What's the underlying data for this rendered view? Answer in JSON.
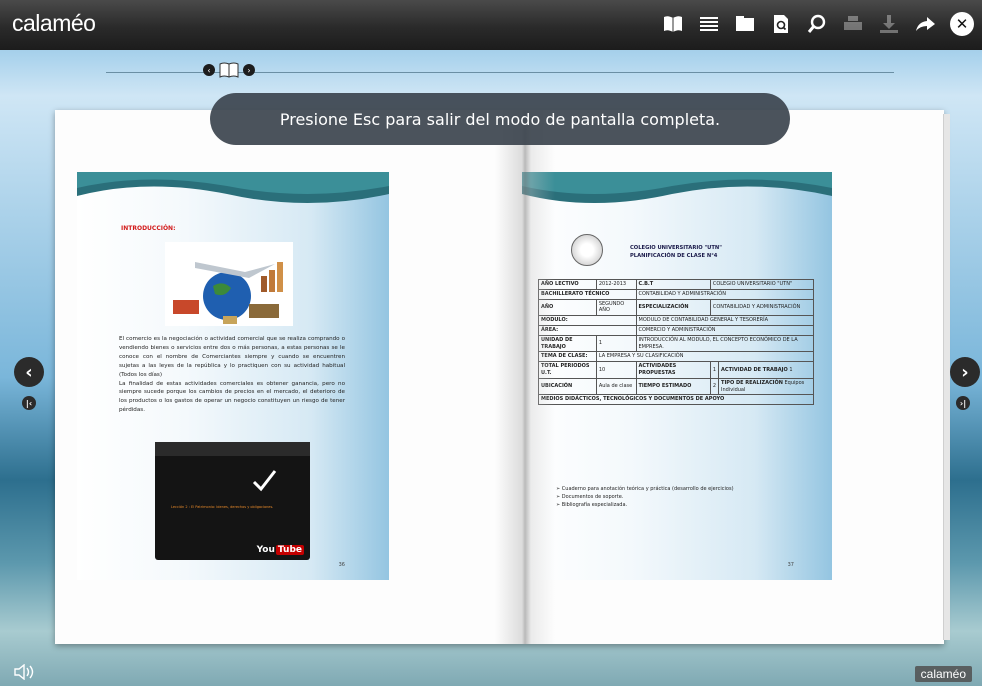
{
  "app": {
    "logo": "calaméo",
    "brand_badge": "calaméo"
  },
  "toolbar": {
    "tools": [
      {
        "name": "book-view-icon",
        "enabled": true
      },
      {
        "name": "list-view-icon",
        "enabled": true
      },
      {
        "name": "folder-icon",
        "enabled": true
      },
      {
        "name": "page-search-icon",
        "enabled": true
      },
      {
        "name": "zoom-icon",
        "enabled": true
      },
      {
        "name": "print-icon",
        "enabled": false
      },
      {
        "name": "download-icon",
        "enabled": false
      },
      {
        "name": "share-icon",
        "enabled": true
      },
      {
        "name": "close-icon",
        "enabled": true
      }
    ]
  },
  "hint": "Presione Esc para salir del modo de pantalla completa.",
  "left_page": {
    "heading": "INTRODUCCIÓN:",
    "paragraph1": "El comercio es la negociación o actividad comercial que se realiza comprando o vendiendo bienes o servicios entre dos o más personas, a estas personas se le conoce con el nombre de Comerciantes siempre y cuando se encuentren sujetas a las leyes de la república y lo practiquen con su actividad habitual (Todos los días)",
    "paragraph2": "La finalidad de estas actividades comerciales es obtener ganancia, pero no siempre sucede porque los cambios de precios en el mercado, el deterioro de los productos o los gastos de operar un negocio constituyen un riesgo de tener pérdidas.",
    "video_caption": "Lección 2 : El Patrimonio: bienes, derechos y obligaciones.",
    "video_brand": "You",
    "video_brand_tube": "Tube",
    "page_number": "36"
  },
  "right_page": {
    "college": "COLEGIO UNIVERSITARIO \"UTN\"",
    "plan_title": "PLANIFICACIÓN DE CLASE N°4",
    "rows": {
      "ano_lectivo_label": "AÑO LECTIVO",
      "ano_lectivo_value": "2012-2013",
      "cbt_label": "C.B.T",
      "cbt_value": "COLEGIO UNIVERSITARIO \"UTN\"",
      "bachillerato_label": "BACHILLERATO TÉCNICO",
      "bachillerato_value": "CONTABILIDAD Y ADMINISTRACIÓN",
      "ano_label": "AÑO",
      "ano_value": "SEGUNDO AÑO",
      "especializacion_label": "ESPECIALIZACIÓN",
      "especializacion_value": "CONTABILIDAD Y ADMINISTRACIÓN",
      "modulo_label": "MODULO:",
      "modulo_value": "MODULO DE CONTABILIDAD GENERAL Y TESORERÍA",
      "area_label": "ÁREA:",
      "area_value": "COMERCIO Y ADMINISTRACIÓN",
      "unidad_label": "UNIDAD DE TRABAJO",
      "unidad_num": "1",
      "unidad_value": "INTRODUCCIÓN AL MODULO, EL CONCEPTO ECONÓMICO DE LA EMPRESA.",
      "tema_label": "TEMA DE CLASE:",
      "tema_value": "LA EMPRESA Y SU CLASIFICACIÓN",
      "total_periodos_label": "TOTAL PERIODOS U.T.",
      "total_periodos_value": "10",
      "actividades_label": "ACTIVIDADES PROPUESTAS",
      "actividades_value": "1",
      "actividad_trabajo_label": "ACTIVIDAD DE TRABAJO",
      "actividad_trabajo_value": "1",
      "ubicacion_label": "UBICACIÓN",
      "ubicacion_value": "Aula de clase",
      "tiempo_label": "TIEMPO ESTIMADO",
      "tiempo_value": "2",
      "tipo_label": "TIPO DE REALIZACIÓN",
      "tipo_value1": "Equipos",
      "tipo_value2": "Individual",
      "medios_label": "MEDIOS DIDÁCTICOS, TECNOLÓGICOS Y DOCUMENTOS DE APOYO"
    },
    "bullets": [
      "Cuaderno para anotación teórica y práctica (desarrollo de ejercicios)",
      "Documentos de soporte.",
      "Bibliografía especializada."
    ],
    "page_number": "37"
  }
}
